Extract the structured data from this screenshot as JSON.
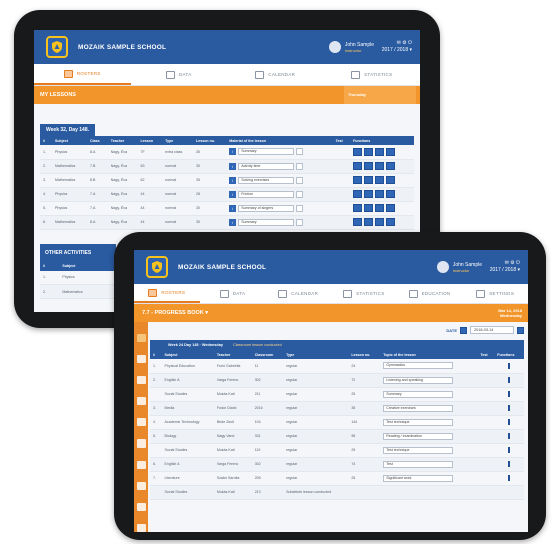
{
  "back": {
    "header": {
      "school": "MOZAIK SAMPLE SCHOOL",
      "user": "John Sample",
      "role": "Instructor",
      "year": "2017 / 2018 ▾"
    },
    "nav": [
      {
        "label": "ROSTERS",
        "active": true
      },
      {
        "label": "DATA",
        "active": false
      },
      {
        "label": "CALENDAR",
        "active": false
      },
      {
        "label": "STATISTICS",
        "active": false
      }
    ],
    "section": {
      "title": "MY LESSONS",
      "day": "Thursday"
    },
    "week_tab": "Week 32, Day 148.",
    "columns": [
      "#",
      "Subject",
      "Class",
      "Teacher",
      "Lesson",
      "Type",
      "Lesson no.",
      "Material of the lesson",
      "Test",
      "Functions"
    ],
    "rows": [
      {
        "n": "1.",
        "subject": "Physics",
        "cls": "8.A",
        "teacher": "Nagy, Éva",
        "room": "7F",
        "type": "extra class",
        "no": "35",
        "material": "Summary"
      },
      {
        "n": "2.",
        "subject": "Mathematics",
        "cls": "7.B",
        "teacher": "Nagy, Éva",
        "room": "63",
        "type": "normal",
        "no": "30",
        "material": "Activity time"
      },
      {
        "n": "3.",
        "subject": "Mathematics",
        "cls": "8.B",
        "teacher": "Nagy, Éva",
        "room": "62",
        "type": "normal",
        "no": "35",
        "material": "Solving exercises"
      },
      {
        "n": "4.",
        "subject": "Physics",
        "cls": "7.A",
        "teacher": "Nagy, Éva",
        "room": "44",
        "type": "normal",
        "no": "28",
        "material": "Friction"
      },
      {
        "n": "5.",
        "subject": "Physics",
        "cls": "7.A",
        "teacher": "Nagy, Éva",
        "room": "44",
        "type": "normal",
        "no": "30",
        "material": "Summary of singers"
      },
      {
        "n": "6.",
        "subject": "Mathematics",
        "cls": "8.A",
        "teacher": "Nagy, Éva",
        "room": "44",
        "type": "normal",
        "no": "30",
        "material": "Summary"
      }
    ],
    "other": {
      "title": "OTHER ACTIVITIES",
      "col": "Subject",
      "rows": [
        "Physics",
        "Mathematics"
      ]
    }
  },
  "front": {
    "header": {
      "school": "MOZAIK SAMPLE SCHOOL",
      "user": "John Sample",
      "role": "Instructor",
      "year": "2017 / 2018 ▾"
    },
    "nav": [
      {
        "label": "ROSTERS",
        "active": true
      },
      {
        "label": "DATA",
        "active": false
      },
      {
        "label": "CALENDAR",
        "active": false
      },
      {
        "label": "STATISTICS",
        "active": false
      },
      {
        "label": "EDUCATION",
        "active": false
      },
      {
        "label": "SETTINGS",
        "active": false
      }
    ],
    "section": {
      "title": "7.7 - PROGRESS BOOK ▾",
      "date_main": "Mar 14, 2018",
      "date_sub": "Wednesday"
    },
    "date_label": "DATE",
    "date_value": "2018-03-14",
    "week_info": "Week 24 Day 145 · Wednesday",
    "notice": "Classroom lesson conducted",
    "columns": [
      "#",
      "Subject",
      "Teacher",
      "Classroom",
      "Type",
      "Lesson no.",
      "Topic of the lesson",
      "Test",
      "Functions"
    ],
    "rows": [
      {
        "n": "1.",
        "subject": "Physical Education",
        "teacher": "Furió Gabriella",
        "room": "11",
        "type": "regular",
        "no": "24",
        "topic": "Gymnastics"
      },
      {
        "n": "2.",
        "subject": "English A",
        "teacher": "Varga Ferenc",
        "room": "302",
        "type": "regular",
        "no": "72",
        "topic": "Listening and speaking"
      },
      {
        "n": "",
        "subject": "Social Studies",
        "teacher": "Mukás Kati",
        "room": "211",
        "type": "regular",
        "no": "25",
        "topic": "Summary"
      },
      {
        "n": "3.",
        "subject": "Media",
        "teacher": "Fodor Dávid",
        "room": "2016",
        "type": "regular",
        "no": "35",
        "topic": "Creative exercises"
      },
      {
        "n": "4.",
        "subject": "Academic Technology",
        "teacher": "Bede Zsolt",
        "room": "104",
        "type": "regular",
        "no": "144",
        "topic": "Test technique"
      },
      {
        "n": "5.",
        "subject": "Biology",
        "teacher": "Nagy Vand",
        "room": "331",
        "type": "regular",
        "no": "96",
        "topic": "Reading / examination"
      },
      {
        "n": "",
        "subject": "Social Studies",
        "teacher": "Mukás Kati",
        "room": "119",
        "type": "regular",
        "no": "29",
        "topic": "Test technique"
      },
      {
        "n": "6.",
        "subject": "English A",
        "teacher": "Varga Ferenc",
        "room": "302",
        "type": "regular",
        "no": "74",
        "topic": "Test"
      },
      {
        "n": "7.",
        "subject": "Literature",
        "teacher": "Szabó Sarolta",
        "room": "205",
        "type": "regular",
        "no": "25",
        "topic": "Significant work"
      },
      {
        "n": "",
        "subject": "Social Studies",
        "teacher": "Mukás Kati",
        "room": "213",
        "type": "Substitute lesson conducted",
        "no": "",
        "topic": ""
      }
    ]
  }
}
